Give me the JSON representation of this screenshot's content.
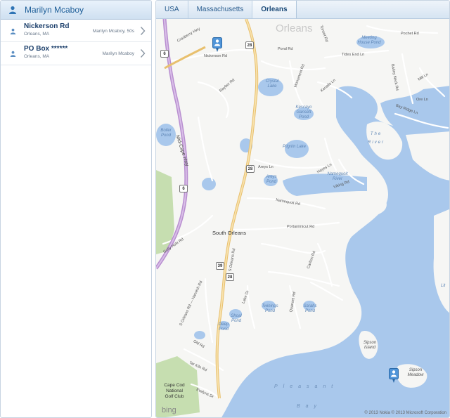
{
  "left": {
    "header_name": "Marilyn Mcaboy",
    "records": [
      {
        "title": "Nickerson Rd",
        "subtitle": "Orleans, MA",
        "owner": "Marilyn Mcaboy, 50s"
      },
      {
        "title": "PO Box ******",
        "subtitle": "Orleans, MA",
        "owner": "Marilyn Mcaboy"
      }
    ]
  },
  "breadcrumb": [
    "USA",
    "Massachusetts",
    "Orleans"
  ],
  "map": {
    "town_labels": {
      "orleans": "Orleans",
      "south_orleans": "South Orleans"
    },
    "water_labels": {
      "meeting_house_pond": "Meeting House Pond",
      "crystal_lake": "Crystal Lake",
      "kescayo_gansett_pond": "Kescayo Gansett Pond",
      "pilgrim_lake": "Pilgrim Lake",
      "areys_pond": "Areys Pond",
      "namequoit_river": "Namequoit River",
      "boiler_pond": "Boiler Pond",
      "the_river": "The River",
      "shoal_pond": "Shoal Pond",
      "twinings_pond": "Twinings Pond",
      "sarahs_pond": "Sarahs Pond",
      "deep_pond": "Deep Pond",
      "sipson_island": "Sipson Island",
      "sipson_meadow": "Sipson Meadow",
      "pleasant": "Pleasant",
      "bay": "Bay",
      "little": "Lit"
    },
    "road_labels": {
      "cranberry_hwy": "Cranberry Hwy",
      "nickerson_rd": "Nickerson Rd",
      "rayber_rd": "Rayber Rd",
      "pond_rd": "Pond Rd",
      "monument_rd": "Monument Rd",
      "tonset_rd": "Tonset Rd",
      "pochet_rd": "Pochet Rd",
      "tides_end_ln": "Tides End Ln",
      "barley_neck_rd": "Barley Neck Rd",
      "kenalls_ln": "Kenalls Ln",
      "ore_ln": "Ore Ln",
      "bay_ridge_ln": "Bay Ridge Ln",
      "mill_ln": "Mill Ln",
      "areys_ln": "Areys Ln",
      "hayes_ln": "Hayes Ln",
      "viking_rd": "Viking Rd",
      "namequoit_rd": "Namequoit Rd",
      "portanimicut_rd": "Portanimicut Rd",
      "carlton_rd": "Carlton Rd",
      "quanset_rd": "Quanset Rd",
      "lake_dr": "Lake Dr",
      "mid_cape_hwy": "Mid-Cape Hwy",
      "s_orleans_rd": "S Orleans Rd",
      "s_orleans_harwich_rd": "S Orleans Rd — Harwich Rd",
      "old_rd": "Old Rd",
      "tar_kiln_rd": "Tar Kiln Rd",
      "evelyns_dr": "Evelyns Dr",
      "gully_hole_rd": "Gully Hole Rd"
    },
    "golf_label": "Cape Cod National Golf Club",
    "shields": [
      "6",
      "6",
      "28",
      "28",
      "39",
      "28"
    ],
    "bing_label": "bing",
    "copyright": "© 2013 Nokia   © 2013 Microsoft Corporation"
  },
  "colors": {
    "water": "#a9c8ec",
    "land": "#f6f6f4",
    "park": "#c6deb0",
    "highway": "#b98fd0",
    "major_road": "#f4d79a",
    "header_blue": "#1f5f99"
  }
}
